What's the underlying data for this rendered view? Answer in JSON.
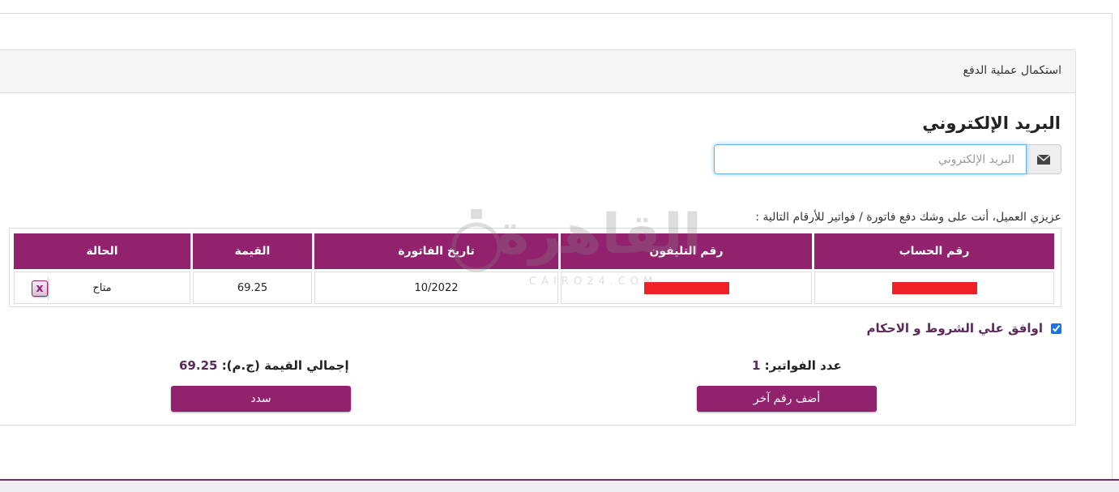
{
  "panel": {
    "title": "استكمال عملية الدفع"
  },
  "email": {
    "heading": "البريد الإلكتروني",
    "placeholder": "البريد الإلكتروني",
    "icon": "envelope-icon"
  },
  "notice": "عزيزي العميل، أنت على وشك دفع فاتورة / فواتير للأرقام التالية :",
  "table": {
    "headers": [
      "رقم الحساب",
      "رقم التليفون",
      "تاريخ الفاتورة",
      "القيمة",
      "الحالة"
    ],
    "rows": [
      {
        "account": "",
        "phone": "",
        "date": "10/2022",
        "amount": "69.25",
        "status": "متاح"
      }
    ],
    "redaction_color": "#ee2126"
  },
  "terms": {
    "label": "اوافق علي الشروط و الاحكام",
    "checked": true
  },
  "summary": {
    "count_label": "عدد الفواتير:",
    "count_value": "1",
    "total_label": "إجمالي القيمة (ج.م):",
    "total_value": "69.25"
  },
  "buttons": {
    "add_label": "أضف رقم آخر",
    "pay_label": "سدد"
  },
  "watermark": {
    "text": "القاهرة",
    "sub": "CAIRO24.COM"
  },
  "colors": {
    "accent": "#93226e",
    "focus": "#66afe9"
  }
}
